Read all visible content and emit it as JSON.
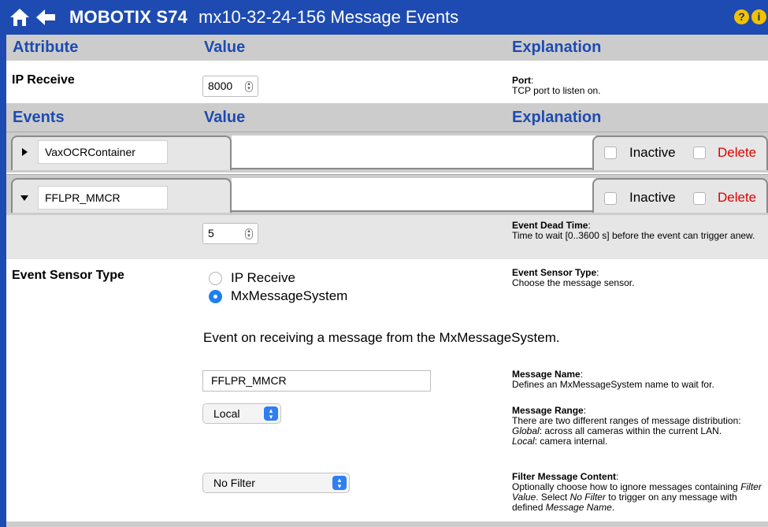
{
  "titlebar": {
    "brand": "MOBOTIX S74",
    "title": "mx10-32-24-156 Message Events",
    "help_glyph": "?",
    "info_glyph": "i"
  },
  "header1": {
    "col1": "Attribute",
    "col2": "Value",
    "col3": "Explanation"
  },
  "ip_receive": {
    "label": "IP Receive",
    "port_value": "8000",
    "expl_title": "Port",
    "expl_text": "TCP port to listen on."
  },
  "header2": {
    "col1": "Events",
    "col2": "Value",
    "col3": "Explanation"
  },
  "events": [
    {
      "name": "VaxOCRContainer",
      "expanded": false,
      "inactive_label": "Inactive",
      "delete_label": "Delete"
    },
    {
      "name": "FFLPR_MMCR",
      "expanded": true,
      "inactive_label": "Inactive",
      "delete_label": "Delete"
    }
  ],
  "dead_time": {
    "value": "5",
    "expl_title": "Event Dead Time",
    "expl_text": "Time to wait [0..3600 s] before the event can trigger anew."
  },
  "sensor_type": {
    "label": "Event Sensor Type",
    "options": [
      {
        "label": "IP Receive",
        "selected": false
      },
      {
        "label": "MxMessageSystem",
        "selected": true
      }
    ],
    "expl_title": "Event Sensor Type",
    "expl_text": "Choose the message sensor.",
    "description": "Event on receiving a message from the MxMessageSystem."
  },
  "message_name": {
    "value": "FFLPR_MMCR",
    "expl_title": "Message Name",
    "expl_text": "Defines an MxMessageSystem name to wait for."
  },
  "message_range": {
    "selected": "Local",
    "expl_title": "Message Range",
    "expl_line1": "There are two different ranges of message distribution:",
    "global_term": "Global",
    "global_text": ": across all cameras within the current LAN.",
    "local_term": "Local",
    "local_text": ": camera internal."
  },
  "filter": {
    "selected": "No Filter",
    "expl_title": "Filter Message Content",
    "expl_a": "Optionally choose how to ignore messages containing ",
    "filter_value_term": "Filter Value",
    "expl_b": ". Select ",
    "no_filter_term": "No Filter",
    "expl_c": " to trigger on any message with defined ",
    "message_name_term": "Message Name",
    "expl_d": "."
  },
  "colors": {
    "brand_blue": "#1e4bb1",
    "header_gray": "#cccccc",
    "row_gray": "#e6e6e6",
    "delete_red": "#e00000",
    "radio_blue": "#1e7ff0"
  },
  "icons": [
    "home-icon",
    "back-arrow-icon",
    "help-icon",
    "info-icon",
    "disclosure-triangle-icon",
    "spinner-icon",
    "select-chevron-icon"
  ]
}
